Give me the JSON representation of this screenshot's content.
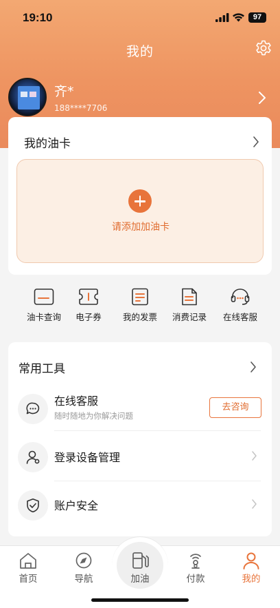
{
  "status_bar": {
    "time": "19:10",
    "battery": "97",
    "signal_icon": "cellular-signal-icon",
    "wifi_icon": "wifi-icon"
  },
  "header": {
    "title": "我的",
    "settings_icon": "gear-icon"
  },
  "profile": {
    "name": "齐*",
    "phone": "188****7706"
  },
  "oil_card": {
    "title": "我的油卡",
    "add_label": "请添加加油卡"
  },
  "quick_actions": [
    {
      "label": "油卡查询",
      "icon": "card-icon"
    },
    {
      "label": "电子券",
      "icon": "coupon-icon"
    },
    {
      "label": "我的发票",
      "icon": "invoice-icon"
    },
    {
      "label": "消费记录",
      "icon": "record-icon"
    },
    {
      "label": "在线客服",
      "icon": "headset-icon"
    }
  ],
  "tools": {
    "title": "常用工具",
    "items": [
      {
        "title": "在线客服",
        "subtitle": "随时随地为你解决问题",
        "button": "去咨询",
        "icon": "chat-icon"
      },
      {
        "title": "登录设备管理",
        "icon": "user-device-icon"
      },
      {
        "title": "账户安全",
        "icon": "shield-check-icon"
      }
    ]
  },
  "tabbar": {
    "active": "我的",
    "accent": "#e8743b",
    "items": [
      {
        "label": "首页",
        "icon": "home-icon"
      },
      {
        "label": "导航",
        "icon": "compass-icon"
      },
      {
        "label": "加油",
        "icon": "fuel-pump-icon"
      },
      {
        "label": "付款",
        "icon": "payment-icon"
      },
      {
        "label": "我的",
        "icon": "person-icon"
      }
    ]
  }
}
